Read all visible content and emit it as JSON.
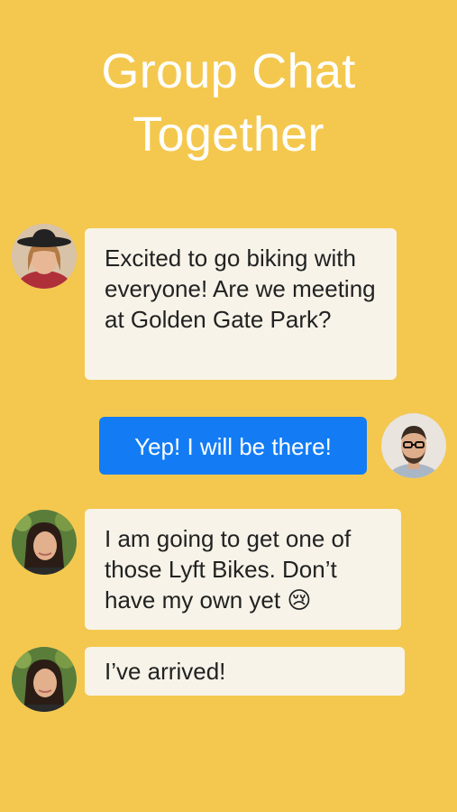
{
  "header": {
    "title_line1": "Group Chat",
    "title_line2": "Together"
  },
  "messages": [
    {
      "sender": "user-1",
      "avatar_icon": "woman-with-hat-avatar-icon",
      "text": "Excited to go biking with everyone! Are we meeting at Golden Gate Park?",
      "direction": "received"
    },
    {
      "sender": "user-2",
      "avatar_icon": "man-with-glasses-avatar-icon",
      "text": "Yep! I will be there!",
      "direction": "sent"
    },
    {
      "sender": "user-3",
      "avatar_icon": "woman-dark-hair-avatar-icon",
      "text": "I am going to get one of those Lyft Bikes. Don’t have my own yet 😢",
      "direction": "received"
    },
    {
      "sender": "user-3",
      "avatar_icon": "woman-dark-hair-avatar-icon",
      "text": "I’ve arrived!",
      "direction": "received"
    }
  ],
  "colors": {
    "background": "#F4C84E",
    "sent_bubble": "#137CF5",
    "received_bubble": "#F7F3E8",
    "title_text": "#FFFFFF"
  }
}
